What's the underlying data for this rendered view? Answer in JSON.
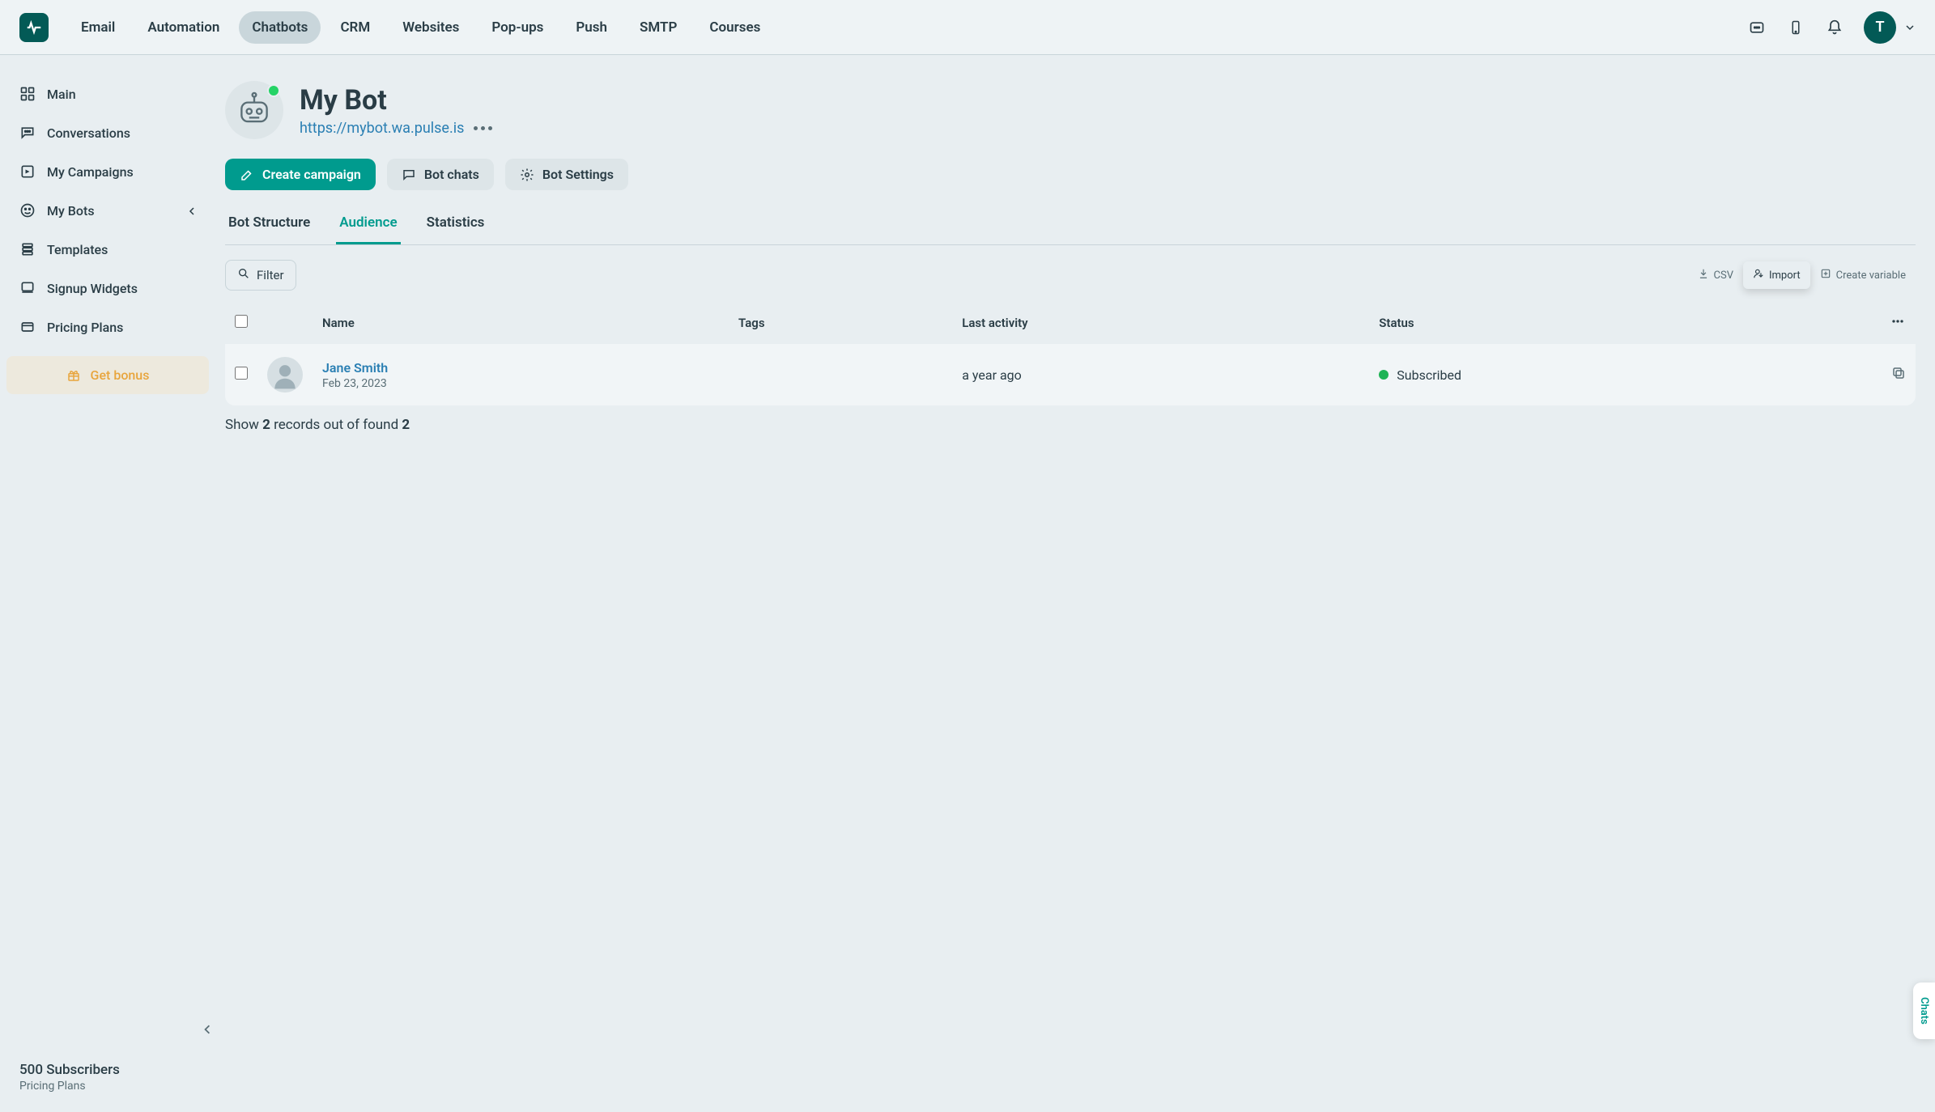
{
  "topnav": {
    "items": [
      {
        "label": "Email"
      },
      {
        "label": "Automation"
      },
      {
        "label": "Chatbots",
        "active": true
      },
      {
        "label": "CRM"
      },
      {
        "label": "Websites"
      },
      {
        "label": "Pop-ups"
      },
      {
        "label": "Push"
      },
      {
        "label": "SMTP"
      },
      {
        "label": "Courses"
      }
    ],
    "avatar_letter": "T"
  },
  "sidebar": {
    "items": [
      {
        "label": "Main",
        "icon": "grid"
      },
      {
        "label": "Conversations",
        "icon": "chat"
      },
      {
        "label": "My Campaigns",
        "icon": "send"
      },
      {
        "label": "My Bots",
        "icon": "face",
        "expandable": true
      },
      {
        "label": "Templates",
        "icon": "stack"
      },
      {
        "label": "Signup Widgets",
        "icon": "widget"
      },
      {
        "label": "Pricing Plans",
        "icon": "price"
      }
    ],
    "bonus_label": "Get bonus",
    "footer": {
      "count": "500 Subscribers",
      "plans": "Pricing Plans"
    }
  },
  "bot": {
    "title": "My Bot",
    "url": "https://mybot.wa.pulse.is"
  },
  "actions": {
    "create_campaign": "Create campaign",
    "bot_chats": "Bot chats",
    "bot_settings": "Bot Settings"
  },
  "tabs": {
    "structure": "Bot Structure",
    "audience": "Audience",
    "statistics": "Statistics"
  },
  "toolbar": {
    "filter": "Filter",
    "csv": "CSV",
    "import": "Import",
    "create_variable": "Create variable"
  },
  "table": {
    "headers": {
      "name": "Name",
      "tags": "Tags",
      "last_activity": "Last activity",
      "status": "Status"
    },
    "rows": [
      {
        "name": "Jane Smith",
        "date": "Feb 23, 2023",
        "tags": "",
        "last_activity": "a year ago",
        "status": "Subscribed"
      }
    ]
  },
  "footer": {
    "show": "Show",
    "count_shown": "2",
    "records_text": "records out of found",
    "count_total": "2"
  },
  "chats_tab": "Chats"
}
